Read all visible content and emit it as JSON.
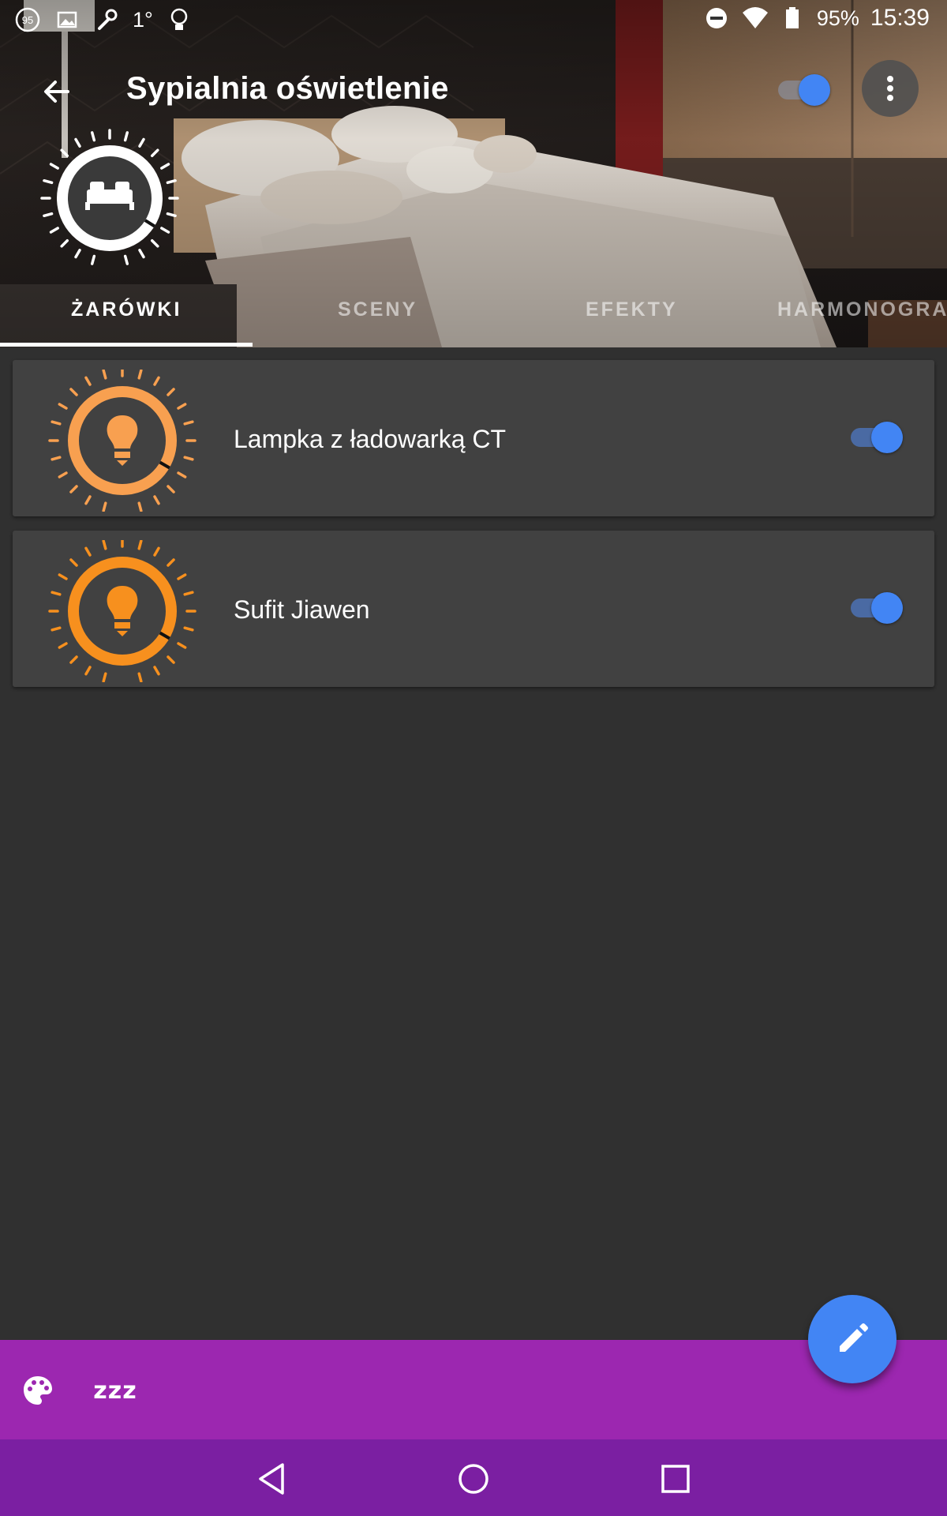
{
  "status_bar": {
    "notification_badge": "95",
    "temperature": "1°",
    "battery_percent": "95%",
    "time": "15:39",
    "icons": [
      "notification-count-icon",
      "image-icon",
      "wrench-icon",
      "bulb-icon",
      "do-not-disturb-icon",
      "wifi-icon",
      "battery-icon"
    ]
  },
  "appbar": {
    "title": "Sypialnia oświetlenie",
    "group_on": true,
    "icons": [
      "back-arrow-icon",
      "more-vert-icon"
    ]
  },
  "room": {
    "icon": "bed-icon"
  },
  "tabs": [
    {
      "label": "ŻARÓWKI",
      "active": true
    },
    {
      "label": "SCENY",
      "active": false
    },
    {
      "label": "EFEKTY",
      "active": false
    },
    {
      "label": "HARMONOGRA",
      "active": false
    }
  ],
  "lights": [
    {
      "name": "Lampka z ładowarką CT",
      "on": true,
      "color": "#f8a050",
      "icon": "lightbulb-icon"
    },
    {
      "name": "Sufit Jiawen",
      "on": true,
      "color": "#f7901e",
      "icon": "lightbulb-icon"
    }
  ],
  "bottom_bar": {
    "icons": [
      "palette-icon",
      "sleep-zzz-icon"
    ],
    "sleep_label": "zzz"
  },
  "fab": {
    "icon": "edit-pencil-icon"
  },
  "nav_bar": {
    "icons": [
      "nav-back-icon",
      "nav-home-icon",
      "nav-recents-icon"
    ]
  },
  "colors": {
    "accent": "#4285f4",
    "bottom_bar": "#9c27b0",
    "nav_bar": "#7b1fa2",
    "background": "#303030",
    "card": "#414141"
  }
}
